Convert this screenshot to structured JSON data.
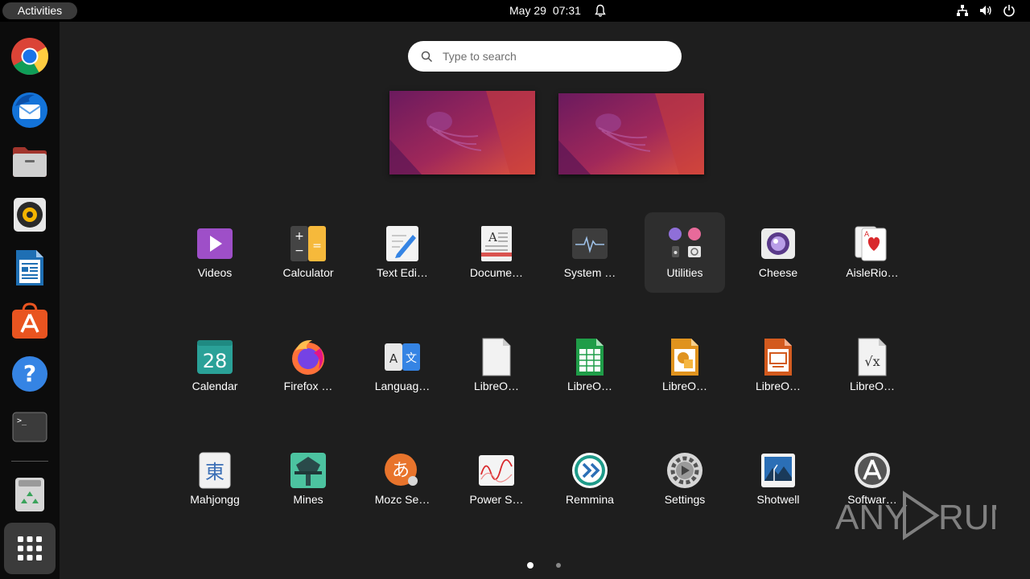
{
  "topbar": {
    "activities": "Activities",
    "date": "May 29",
    "time": "07:31",
    "bell_icon": "bell-icon",
    "tray_icons": [
      "network-icon",
      "volume-icon",
      "power-icon"
    ]
  },
  "dock": {
    "items": [
      {
        "name": "chrome",
        "icon": "chrome-icon"
      },
      {
        "name": "thunderbird",
        "icon": "thunderbird-icon"
      },
      {
        "name": "files",
        "icon": "files-icon"
      },
      {
        "name": "rhythmbox",
        "icon": "rhythmbox-icon"
      },
      {
        "name": "libreoffice-writer",
        "icon": "writer-icon"
      },
      {
        "name": "software",
        "icon": "software-icon"
      },
      {
        "name": "help",
        "icon": "help-icon"
      },
      {
        "name": "terminal",
        "icon": "terminal-icon"
      },
      {
        "name": "trash",
        "icon": "trash-icon"
      }
    ],
    "show_apps_icon": "grid-icon"
  },
  "search": {
    "placeholder": "Type to search"
  },
  "apps": [
    [
      "Videos",
      "Calculator",
      "Text Edi…",
      "Docume…",
      "System …",
      "Utilities",
      "Cheese",
      "AisleRio…"
    ],
    [
      "Calendar",
      "Firefox …",
      "Languag…",
      "LibreO…",
      "LibreO…",
      "LibreO…",
      "LibreO…",
      "LibreO…"
    ],
    [
      "Mahjongg",
      "Mines",
      "Mozc Se…",
      "Power S…",
      "Remmina",
      "Settings",
      "Shotwell",
      "Softwar…"
    ]
  ],
  "calendar_day": "28",
  "active_app": "Utilities",
  "pager": {
    "pages": 2,
    "current": 1
  },
  "watermark": "ANY RUN",
  "colors": {
    "accent": "#e95420",
    "background": "#1e1e1e",
    "topbar": "#000000"
  }
}
